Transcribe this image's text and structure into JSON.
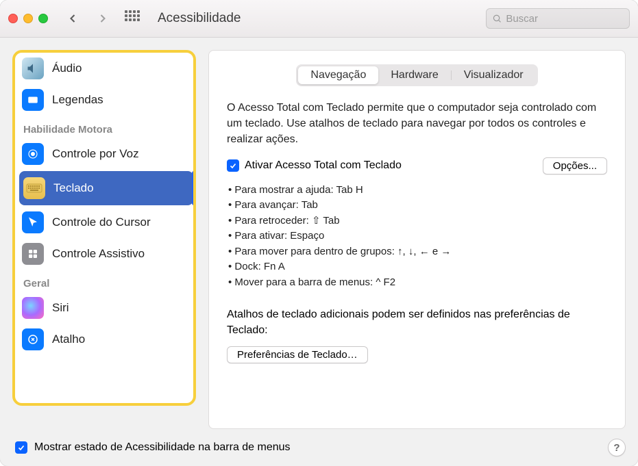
{
  "window": {
    "title": "Acessibilidade",
    "search_placeholder": "Buscar"
  },
  "sidebar": {
    "items": {
      "audio": "Áudio",
      "captions": "Legendas",
      "section_motor": "Habilidade Motora",
      "voice_control": "Controle por Voz",
      "keyboard": "Teclado",
      "cursor_control": "Controle do Cursor",
      "switch_control": "Controle Assistivo",
      "section_general": "Geral",
      "siri": "Siri",
      "shortcut": "Atalho"
    }
  },
  "tabs": {
    "navigation": "Navegação",
    "hardware": "Hardware",
    "viewer": "Visualizador"
  },
  "panel": {
    "description": "O Acesso Total com Teclado permite que o computador seja controlado com um teclado. Use atalhos de teclado para navegar por todos os controles e realizar ações.",
    "enable_label": "Ativar Acesso Total com Teclado",
    "options_button": "Opções...",
    "hints": [
      "• Para mostrar a ajuda: Tab H",
      "• Para avançar: Tab",
      "• Para retroceder: ⇧ Tab",
      "• Para ativar: Espaço",
      "• Para mover para dentro de grupos: ↑, ↓, ← e →",
      "• Dock: Fn A",
      "• Mover para a barra de menus: ^ F2"
    ],
    "extra_text": "Atalhos de teclado adicionais podem ser definidos nas preferências de Teclado:",
    "kb_prefs_button": "Preferências de Teclado…"
  },
  "footer": {
    "menubar_label": "Mostrar estado de Acessibilidade na barra de menus"
  }
}
